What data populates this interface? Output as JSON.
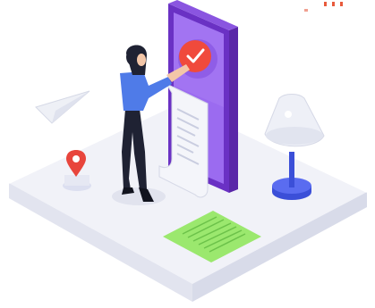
{
  "scene": {
    "kind": "isometric-illustration",
    "icons": [
      "smartphone-icon",
      "checkmark-badge-icon",
      "receipt-icon",
      "woman-figure-icon",
      "paper-plane-icon",
      "location-pin-icon",
      "desk-lamp-icon",
      "document-icon"
    ],
    "colors": {
      "platform_top": "#f1f2f8",
      "platform_side": "#e2e4ef",
      "phone_body": "#7b3fd6",
      "phone_screen": "#9b6bf0",
      "badge": "#f04a3c",
      "receipt": "#f4f5fa",
      "lamp_shade": "#eef0f7",
      "lamp_base": "#3b4fd8",
      "document": "#9be86e",
      "shirt": "#4f7be8",
      "trousers": "#1f2233",
      "pin": "#e8453c"
    }
  }
}
